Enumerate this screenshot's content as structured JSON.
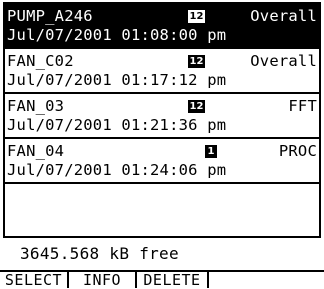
{
  "files": [
    {
      "name": "PUMP_A246",
      "badge": "12",
      "type": "Overall",
      "date": "Jul/07/2001",
      "time": "01:08:00 pm",
      "selected": true
    },
    {
      "name": "FAN_C02",
      "badge": "12",
      "type": "Overall",
      "date": "Jul/07/2001",
      "time": "01:17:12 pm",
      "selected": false
    },
    {
      "name": "FAN_03",
      "badge": "12",
      "type": "FFT",
      "date": "Jul/07/2001",
      "time": "01:21:36 pm",
      "selected": false
    },
    {
      "name": "FAN_04",
      "badge": "1",
      "type": "PROC",
      "date": "Jul/07/2001",
      "time": "01:24:06 pm",
      "selected": false
    }
  ],
  "status": {
    "free_space": "3645.568 kB free"
  },
  "softkeys": {
    "select": "SELECT",
    "info": "INFO",
    "delete": "DELETE"
  },
  "colors": {
    "background": "#ffffff",
    "foreground": "#000000"
  }
}
